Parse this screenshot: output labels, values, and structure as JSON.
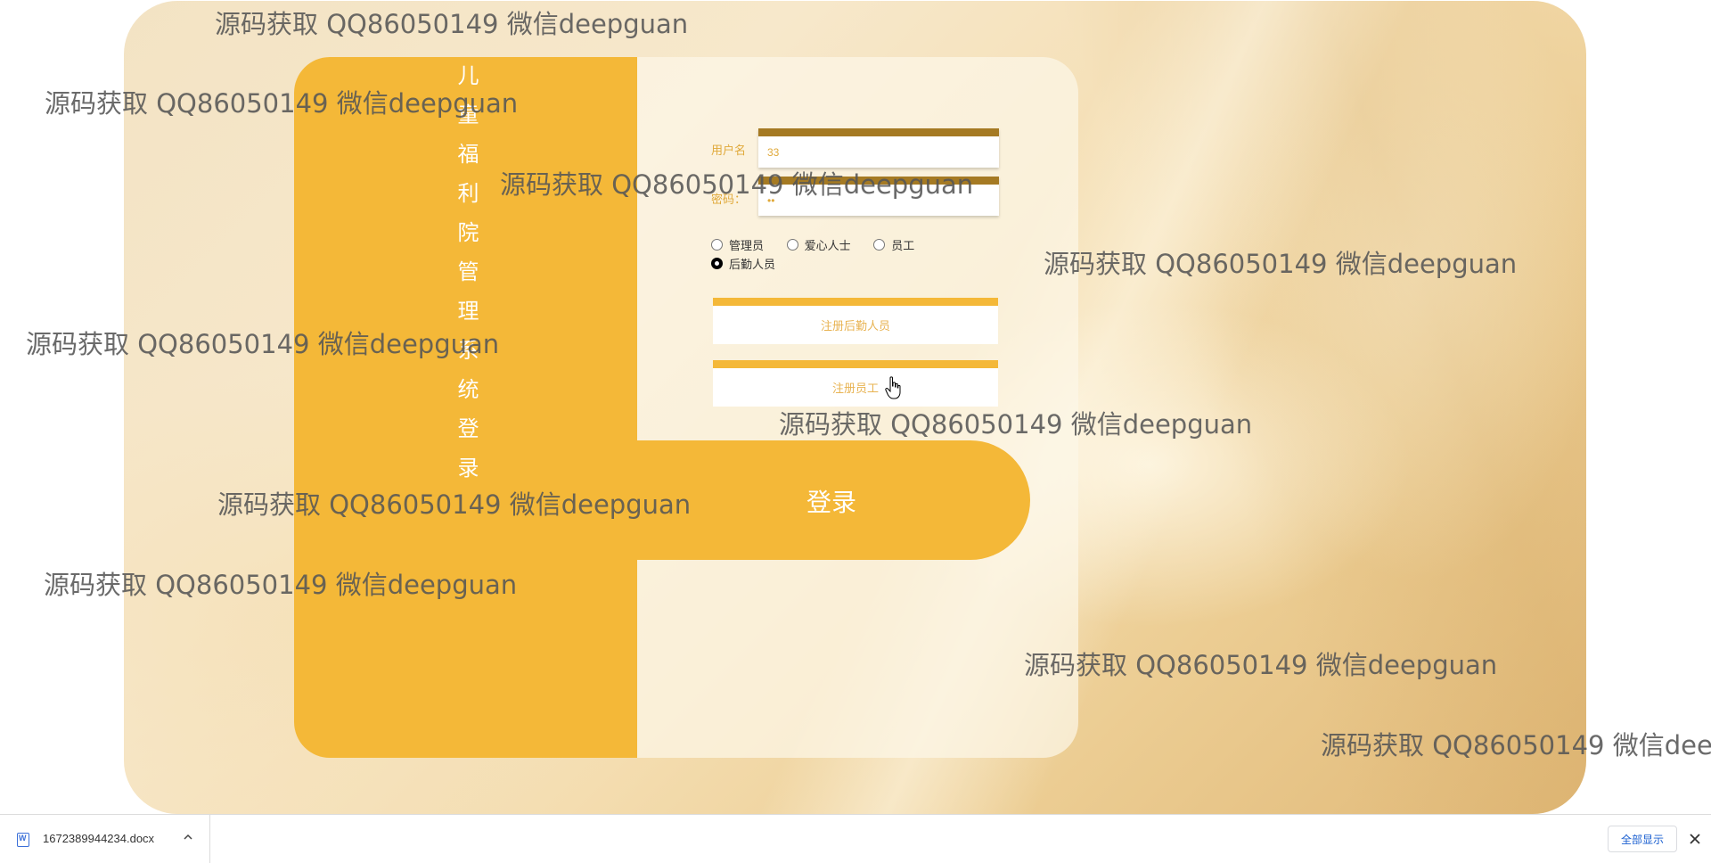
{
  "login": {
    "title": "儿童福利院管理系统登录",
    "username_label": "用户名",
    "username_value": "33",
    "password_label": "密码：",
    "password_value": "••",
    "roles": [
      {
        "label": "管理员",
        "checked": false
      },
      {
        "label": "爱心人士",
        "checked": false
      },
      {
        "label": "员工",
        "checked": false
      },
      {
        "label": "后勤人员",
        "checked": true
      }
    ],
    "register_logistics_label": "注册后勤人员",
    "register_staff_label": "注册员工",
    "login_label": "登录"
  },
  "watermark_text": "源码获取 QQ86050149 微信deepguan",
  "watermark_partial_text": "源码获取 QQ86050149 微信dee",
  "download_bar": {
    "file_name": "1672389944234.docx",
    "show_all_label": "全部显示"
  },
  "colors": {
    "accent": "#f4b838",
    "field_bar": "#a57a23",
    "label": "#e0a93a"
  }
}
